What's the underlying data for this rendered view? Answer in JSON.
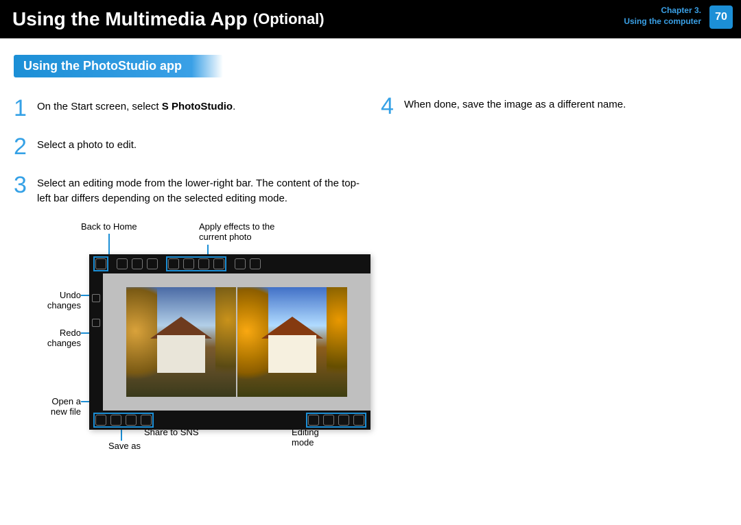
{
  "header": {
    "title_main": "Using the Multimedia App",
    "title_optional": "(Optional)",
    "chapter_line1": "Chapter 3.",
    "chapter_line2": "Using the computer",
    "page": "70"
  },
  "section_title": "Using the PhotoStudio app",
  "steps": {
    "s1": {
      "num": "1",
      "pre": "On the Start screen, select ",
      "bold": "S PhotoStudio",
      "post": "."
    },
    "s2": {
      "num": "2",
      "text": "Select a photo to edit."
    },
    "s3": {
      "num": "3",
      "text": "Select an editing mode from the lower-right bar. The content of the top-left bar differs depending on the selected editing mode."
    },
    "s4": {
      "num": "4",
      "text": "When done, save the image as a different name."
    }
  },
  "callouts": {
    "back_home": "Back to Home",
    "apply_fx_l1": "Apply effects to the",
    "apply_fx_l2": "current photo",
    "undo_l1": "Undo",
    "undo_l2": "changes",
    "redo_l1": "Redo",
    "redo_l2": "changes",
    "open_l1": "Open a",
    "open_l2": "new file",
    "saveas": "Save as",
    "share": "Share to SNS",
    "editmode": "Editing mode"
  }
}
